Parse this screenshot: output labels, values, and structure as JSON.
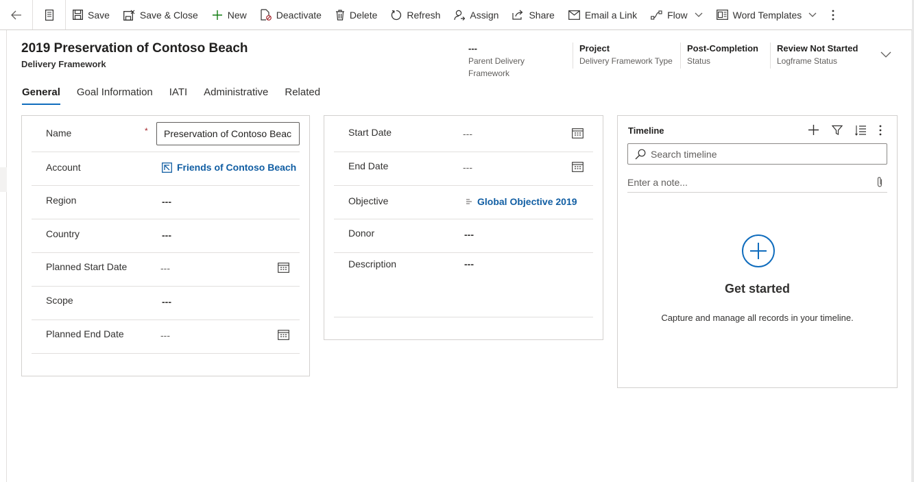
{
  "toolbar": {
    "back_icon": "back-arrow-icon",
    "form_icon": "form-icon",
    "save": "Save",
    "save_close": "Save & Close",
    "new": "New",
    "deactivate": "Deactivate",
    "delete": "Delete",
    "refresh": "Refresh",
    "assign": "Assign",
    "share": "Share",
    "email_link": "Email a Link",
    "flow": "Flow",
    "word_templates": "Word Templates"
  },
  "header": {
    "title": "2019 Preservation of Contoso Beach",
    "entity": "Delivery Framework",
    "fields": [
      {
        "value": "---",
        "label": "Parent Delivery Framework"
      },
      {
        "value": "Project",
        "label": "Delivery Framework Type"
      },
      {
        "value": "Post-Completion",
        "label": "Status"
      },
      {
        "value": "Review Not Started",
        "label": "Logframe Status"
      }
    ]
  },
  "tabs": [
    {
      "label": "General",
      "active": true
    },
    {
      "label": "Goal Information",
      "active": false
    },
    {
      "label": "IATI",
      "active": false
    },
    {
      "label": "Administrative",
      "active": false
    },
    {
      "label": "Related",
      "active": false
    }
  ],
  "general": {
    "name_label": "Name",
    "name_required": "*",
    "name_value": "Preservation of Contoso Beach",
    "account_label": "Account",
    "account_value": "Friends of Contoso Beach",
    "region_label": "Region",
    "region_value": "---",
    "country_label": "Country",
    "country_value": "---",
    "planned_start_label": "Planned Start Date",
    "planned_start_value": "---",
    "scope_label": "Scope",
    "scope_value": "---",
    "planned_end_label": "Planned End Date",
    "planned_end_value": "---"
  },
  "details": {
    "start_label": "Start Date",
    "start_value": "---",
    "end_label": "End Date",
    "end_value": "---",
    "objective_label": "Objective",
    "objective_value": "Global Objective 2019",
    "donor_label": "Donor",
    "donor_value": "---",
    "description_label": "Description",
    "description_value": "---"
  },
  "timeline": {
    "title": "Timeline",
    "search_placeholder": "Search timeline",
    "note_placeholder": "Enter a note...",
    "get_started": "Get started",
    "caption": "Capture and manage all records in your timeline."
  },
  "colors": {
    "accent": "#0f6cbd",
    "link": "#115ea3",
    "required": "#a4262c"
  }
}
